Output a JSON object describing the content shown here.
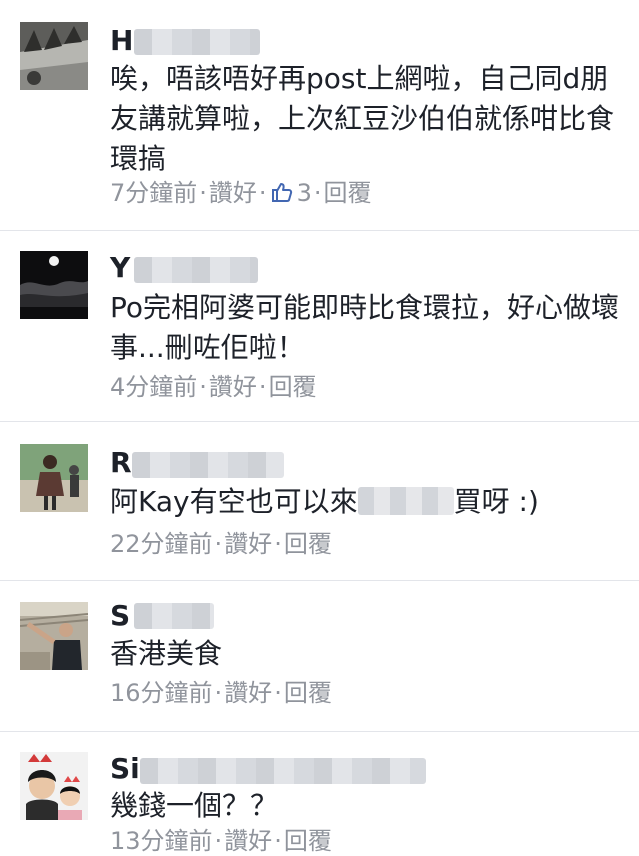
{
  "comments": [
    {
      "name_visible": "H",
      "text": "唉，唔該唔好再post上網啦，自己同d朋友講就算啦，上次紅豆沙伯伯就係咁比食環搞",
      "time": "7分鐘前",
      "like_label": "讚好",
      "like_count": "3",
      "reply_label": "回覆"
    },
    {
      "name_visible": "Y",
      "text": "Po完相阿婆可能即時比食環拉，好心做壞事...刪咗佢啦！",
      "time": "4分鐘前",
      "like_label": "讚好",
      "reply_label": "回覆"
    },
    {
      "name_visible": "R",
      "text_before": "阿Kay有空也可以來",
      "text_after": "買呀 :)",
      "time": "22分鐘前",
      "like_label": "讚好",
      "reply_label": "回覆"
    },
    {
      "name_visible": "S",
      "text": "香港美食",
      "time": "16分鐘前",
      "like_label": "讚好",
      "reply_label": "回覆"
    },
    {
      "name_visible": "Si",
      "text": "幾錢一個？？",
      "time": "13分鐘前",
      "like_label": "讚好",
      "reply_label": "回覆"
    }
  ],
  "icons": {
    "like": "thumbs-up-icon"
  },
  "colors": {
    "text": "#1d2129",
    "meta": "#90949c",
    "like_blue": "#4267b2"
  }
}
